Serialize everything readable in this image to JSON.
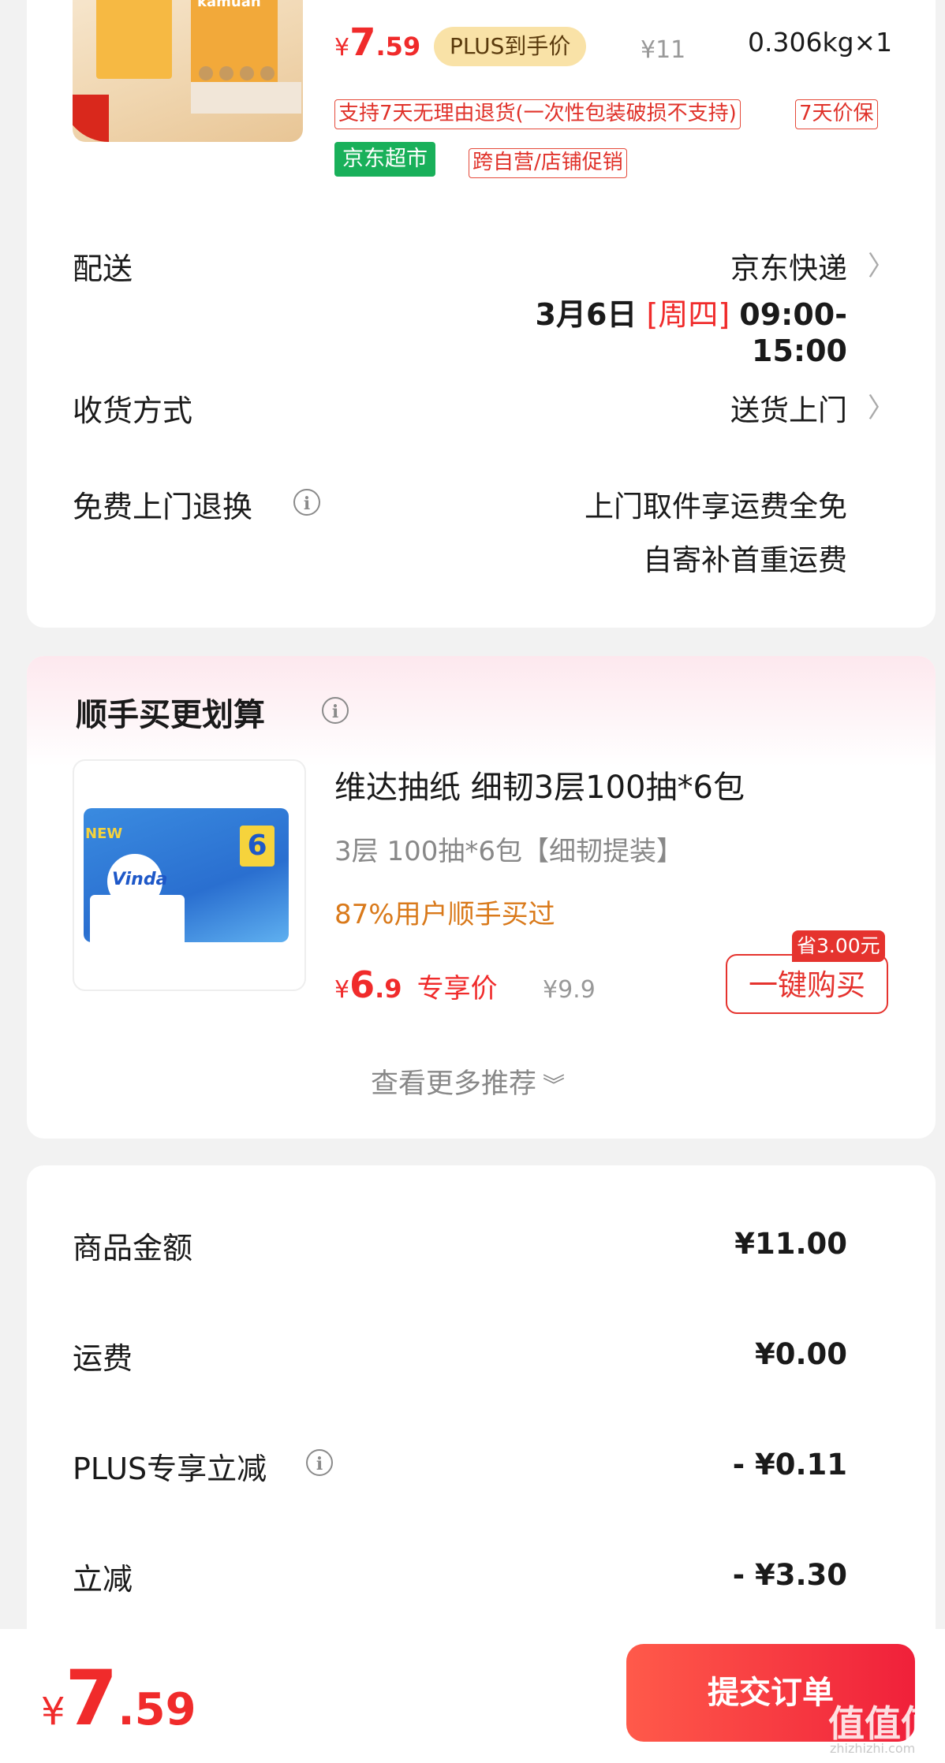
{
  "product": {
    "price_symbol": "¥",
    "price_int": "7",
    "price_dec": ".59",
    "plus_tag": "PLUS到手价",
    "orig_price": "¥11",
    "weight_qty": "0.306kg×1",
    "box_text": "kamuah",
    "tags": [
      "支持7天无理由退货(一次性包装破损不支持)",
      "7天价保"
    ],
    "jd_tag": "京东超市",
    "promo_tag": "跨自营/店铺促销"
  },
  "delivery": {
    "label": "配送",
    "method": "京东快递",
    "date": "3月6日",
    "weekday": "[周四]",
    "time": "09:00-15:00"
  },
  "receive": {
    "label": "收货方式",
    "value": "送货上门"
  },
  "returns": {
    "label": "免费上门退换",
    "line1": "上门取件享运费全免",
    "line2": "自寄补首重运费"
  },
  "recommend": {
    "title": "顺手买更划算",
    "name": "维达抽纸 细韧3层100抽*6包",
    "spec": "3层 100抽*6包【细韧提装】",
    "stat": "87%用户顺手买过",
    "price_symbol": "¥",
    "price_int": "6",
    "price_dec": ".9",
    "price_tag": "专享价",
    "orig": "¥9.9",
    "save_badge": "省3.00元",
    "buy_label": "一键购买",
    "more": "查看更多推荐",
    "pack_brand": "Vinda",
    "pack_count": "6",
    "pack_new": "NEW"
  },
  "summary": {
    "rows": [
      {
        "label": "商品金额",
        "value": "¥11.00"
      },
      {
        "label": "运费",
        "value": "¥0.00"
      },
      {
        "label": "PLUS专享立减",
        "value": "- ¥0.11"
      },
      {
        "label": "立减",
        "value": "- ¥3.30"
      }
    ]
  },
  "footer": {
    "price_symbol": "¥",
    "price_int": "7",
    "price_dec": ".59",
    "submit_label": "提交订单",
    "watermark": "值值值",
    "watermark_url": "zhizhizhi.com"
  },
  "colors": {
    "accent": "#f02b2b",
    "plus": "#f9e2a7",
    "green": "#19b05a",
    "orange": "#d9791a"
  },
  "icons": [
    "chevron-right-icon",
    "info-icon",
    "chevron-down-icon"
  ]
}
